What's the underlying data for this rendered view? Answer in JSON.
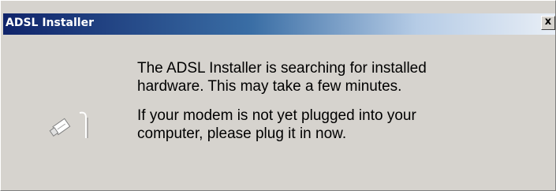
{
  "window": {
    "title": "ADSL Installer",
    "close_glyph": "x",
    "close_icon": "close-icon"
  },
  "content": {
    "icon": "usb-cable-icon",
    "paragraph_1": "The ADSL Installer is searching for installed\nhardware.  This may take a few minutes.",
    "paragraph_2": "If your modem is not yet plugged into your\ncomputer, please plug it in now."
  },
  "colors": {
    "window_bg": "#d6d3ce",
    "titlebar_start": "#10246a",
    "titlebar_end": "#e8eef6",
    "title_text": "#ffffff"
  }
}
